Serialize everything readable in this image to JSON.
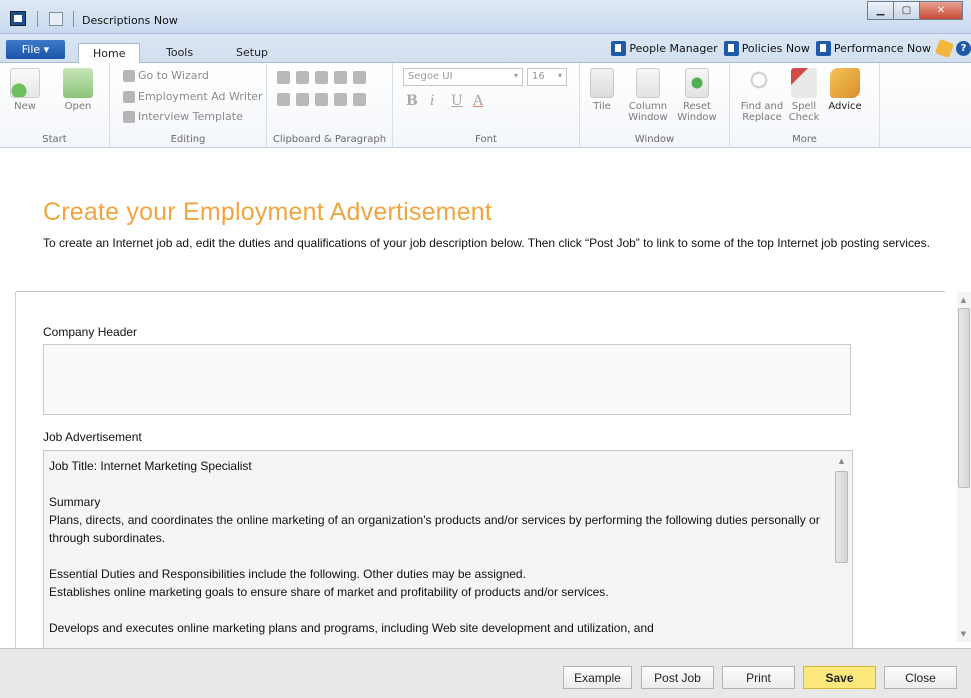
{
  "window": {
    "title": "Descriptions Now"
  },
  "ribbon": {
    "file_tab": "File ▾",
    "tabs": [
      "Home",
      "Tools",
      "Setup"
    ],
    "top_links": [
      "People Manager",
      "Policies Now",
      "Performance Now"
    ],
    "help": "?",
    "groups": {
      "start": {
        "label": "Start",
        "new": "New",
        "open": "Open"
      },
      "editing": {
        "label": "Editing",
        "go_to_wizard": "Go to Wizard",
        "employment_ad_writer": "Employment Ad Writer",
        "interview_template": "Interview Template"
      },
      "clipboard": {
        "label": "Clipboard & Paragraph"
      },
      "font": {
        "label": "Font",
        "font_name": "Segoe UI",
        "font_size": "16",
        "bold": "B",
        "italic": "i",
        "underline": "U",
        "color": "A"
      },
      "window": {
        "label": "Window",
        "tile": "Tile",
        "column_window": "Column Window",
        "reset_window": "Reset Window"
      },
      "more": {
        "label": "More",
        "find_replace": "Find and Replace",
        "spell_check": "Spell Check",
        "advice": "Advice"
      }
    }
  },
  "content": {
    "title": "Create your Employment Advertisement",
    "description": "To create an Internet job ad, edit the duties and qualifications of your job description below. Then click “Post Job” to link to some of the top Internet job posting services.",
    "company_header_label": "Company Header",
    "company_header_value": "",
    "job_ad_label": "Job Advertisement",
    "job_ad_lines": {
      "l1": "Job Title: Internet Marketing Specialist",
      "l2": "Summary",
      "l3": "Plans, directs, and coordinates the online marketing of an organization's products and/or services by performing the following duties personally or through subordinates.",
      "l4": "Essential Duties and Responsibilities include the following. Other duties may be assigned.",
      "l5": "Establishes online marketing goals to ensure share of market and profitability of products and/or services.",
      "l6": "Develops and executes online marketing plans and programs, including Web site development and utilization, and"
    }
  },
  "footer": {
    "example": "Example",
    "post_job": "Post Job",
    "print": "Print",
    "save": "Save",
    "close": "Close"
  },
  "colors": {
    "accent_orange": "#f0a540",
    "save_yellow": "#fde87d",
    "file_blue": "#1c55a8"
  }
}
